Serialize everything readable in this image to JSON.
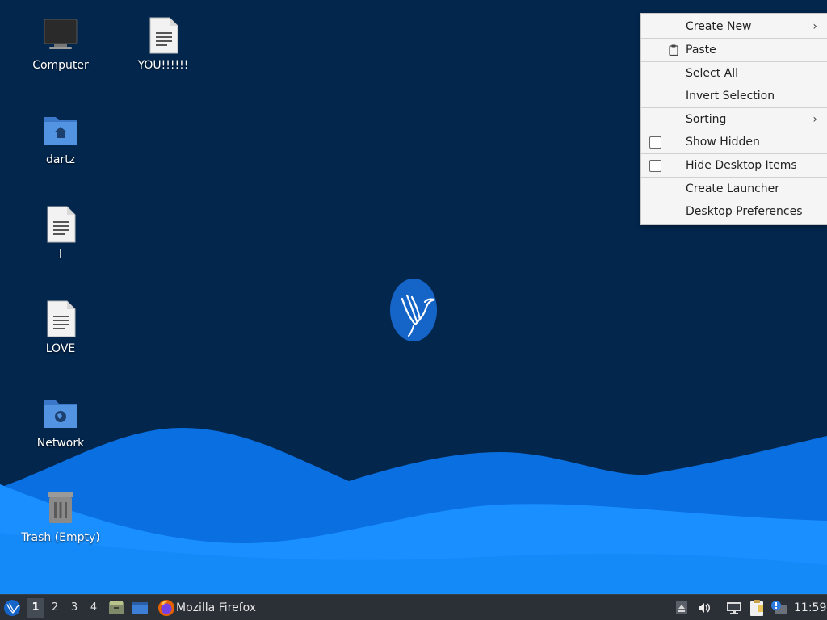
{
  "desktop": {
    "icons": [
      {
        "label": "Computer"
      },
      {
        "label": "YOU!!!!!!"
      },
      {
        "label": "dartz"
      },
      {
        "label": "I"
      },
      {
        "label": "LOVE"
      },
      {
        "label": "Network"
      },
      {
        "label": "Trash (Empty)"
      }
    ]
  },
  "context_menu": {
    "items": {
      "create_new": "Create New",
      "paste": "Paste",
      "select_all": "Select All",
      "invert_selection": "Invert Selection",
      "sorting": "Sorting",
      "show_hidden": "Show Hidden",
      "hide_desktop_items": "Hide Desktop Items",
      "create_launcher": "Create Launcher",
      "desktop_preferences": "Desktop Preferences"
    }
  },
  "taskbar": {
    "workspaces": [
      "1",
      "2",
      "3",
      "4"
    ],
    "active_workspace": "1",
    "window_title": "Mozilla Firefox",
    "clock": "11:59"
  },
  "colors": {
    "background": "#03264d",
    "wave_light": "#1a8fff",
    "wave_dark": "#0a6fe0",
    "taskbar": "#2b2f36",
    "menu": "#f5f5f5"
  },
  "icons": {
    "launcher": "lubuntu-bird-icon",
    "files": "file-manager-icon",
    "desktop": "show-desktop-icon",
    "browser": "firefox-icon",
    "tray": [
      "eject-icon",
      "volume-icon",
      "network-icon",
      "clipboard-icon",
      "update-notifier-icon"
    ]
  }
}
